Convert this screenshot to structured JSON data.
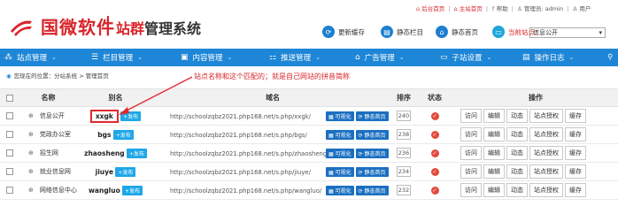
{
  "header": {
    "logo_main": "国微软件",
    "logo_sub_red": "站群",
    "logo_sub_plain": "管理系统",
    "top_links": {
      "backend": "后台首页",
      "main_site": "主站首页",
      "help": "帮助",
      "admin": "管理员: admin",
      "user_cut": "用户"
    },
    "buttons": {
      "update_cache": "更新缓存",
      "static_column": "静态栏目",
      "static_home": "静态首页",
      "current_site": "当前站点："
    },
    "site_select": "信息公开",
    "cut_btn": "查"
  },
  "nav": {
    "items": [
      {
        "label": "站点管理"
      },
      {
        "label": "栏目管理"
      },
      {
        "label": "内容管理"
      },
      {
        "label": "推送管理"
      },
      {
        "label": "广告管理"
      },
      {
        "label": "子站设置"
      },
      {
        "label": "操作日志"
      }
    ]
  },
  "breadcrumb": "您现在的位置：分站系统 > 管理首页",
  "annotation": "站点名称和这个匹配的；就是自己网站的拼音简称",
  "table": {
    "headers": {
      "name": "名称",
      "alias": "别名",
      "domain": "域名",
      "sort": "排序",
      "status": "状态",
      "ops": "操作"
    },
    "publish_label": "+发布",
    "visual_label": "可视化",
    "static_label": "静态首页",
    "op_labels": [
      "访问",
      "编辑",
      "动态",
      "站点授权",
      "缓存"
    ],
    "status_symbol": "✓",
    "rows": [
      {
        "name": "信息公开",
        "alias": "xxgk",
        "domain": "http://schoolzqbz2021.php168.net/s.php/xxgk/",
        "sort": "240"
      },
      {
        "name": "党政办公室",
        "alias": "bgs",
        "domain": "http://schoolzqbz2021.php168.net/s.php/bgs/",
        "sort": "238"
      },
      {
        "name": "招生网",
        "alias": "zhaosheng",
        "domain": "http://schoolzqbz2021.php168.net/s.php/zhaosheng/",
        "sort": "236"
      },
      {
        "name": "就业信息网",
        "alias": "jiuye",
        "domain": "http://schoolzqbz2021.php168.net/s.php/jiuye/",
        "sort": "234"
      },
      {
        "name": "网络信息中心",
        "alias": "wangluo",
        "domain": "http://schoolzqbz2021.php168.net/s.php/wangluo/",
        "sort": "232"
      }
    ]
  },
  "colors": {
    "brand_red": "#d9252b",
    "nav_blue": "#1e86d6",
    "button_blue": "#1b6fc2",
    "publish_blue": "#1ea7e8",
    "status_red": "#e14b3b"
  }
}
